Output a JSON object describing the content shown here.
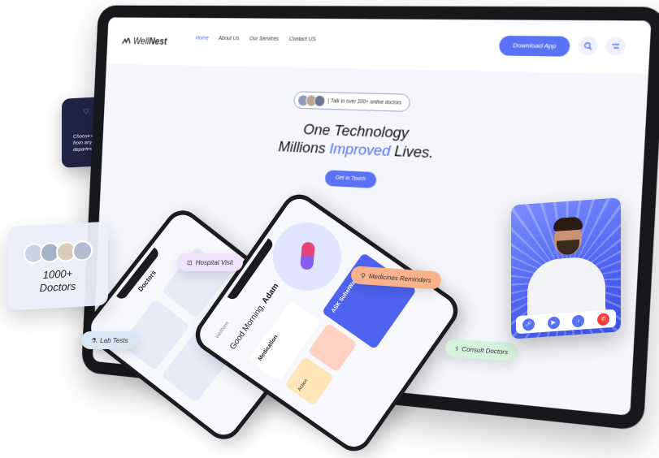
{
  "nav": {
    "logo_light": "Well",
    "logo_bold": "Nest",
    "items": [
      "Home",
      "About Us",
      "Our Services",
      "Contact US"
    ],
    "download_label": "Download App"
  },
  "hero": {
    "pill_text": "| Talk to over 100+ online doctors",
    "line1": "One Technology",
    "line2_pre": "Millions ",
    "line2_accent": "Improved",
    "line2_post": " Lives.",
    "cta": "Get in Touch"
  },
  "phones": {
    "front_logo": "WellNest",
    "greeting_pre": "Good Morning, ",
    "greeting_name": "Adam",
    "back_title": "Doctors",
    "tile_medication": "Medication",
    "tile_action": "Action",
    "tile_ask": "ASK SuheiWaiy"
  },
  "chips": {
    "hospital": "Hospital Visit",
    "medicines": "Medicines Reminders",
    "lab": "Lab Tests",
    "consult": "Consult Doctors"
  },
  "dept_card": {
    "text": "Choose experts from any department"
  },
  "doctors_card": {
    "count": "1000+",
    "label": "Doctors"
  },
  "colors": {
    "accent": "#5a72f5",
    "hospital_chip": "#efe3fb",
    "medicines_chip": "#f8b28c",
    "lab_chip": "#dbe6f5",
    "consult_chip": "#d6f2dc",
    "end_call": "#ef3e3e"
  },
  "icons": [
    "search-icon",
    "menu-icon",
    "heart-icon",
    "brain-icon",
    "tooth-icon",
    "video-icon",
    "phone-end-icon"
  ]
}
